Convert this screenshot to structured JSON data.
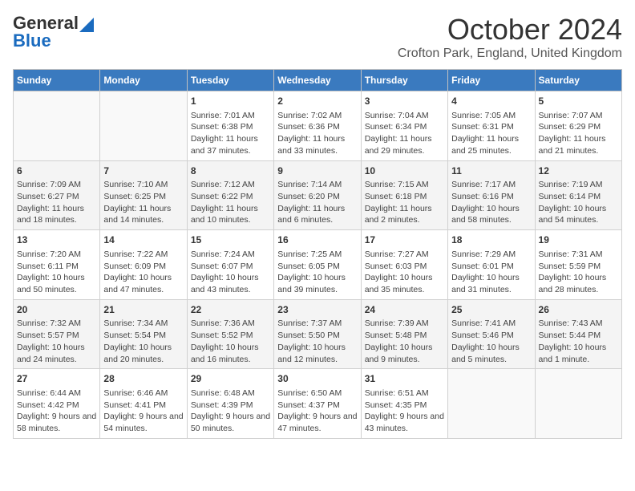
{
  "header": {
    "logo_line1": "General",
    "logo_line2": "Blue",
    "month_title": "October 2024",
    "location": "Crofton Park, England, United Kingdom"
  },
  "weekdays": [
    "Sunday",
    "Monday",
    "Tuesday",
    "Wednesday",
    "Thursday",
    "Friday",
    "Saturday"
  ],
  "weeks": [
    [
      {
        "day": "",
        "info": ""
      },
      {
        "day": "",
        "info": ""
      },
      {
        "day": "1",
        "info": "Sunrise: 7:01 AM\nSunset: 6:38 PM\nDaylight: 11 hours and 37 minutes."
      },
      {
        "day": "2",
        "info": "Sunrise: 7:02 AM\nSunset: 6:36 PM\nDaylight: 11 hours and 33 minutes."
      },
      {
        "day": "3",
        "info": "Sunrise: 7:04 AM\nSunset: 6:34 PM\nDaylight: 11 hours and 29 minutes."
      },
      {
        "day": "4",
        "info": "Sunrise: 7:05 AM\nSunset: 6:31 PM\nDaylight: 11 hours and 25 minutes."
      },
      {
        "day": "5",
        "info": "Sunrise: 7:07 AM\nSunset: 6:29 PM\nDaylight: 11 hours and 21 minutes."
      }
    ],
    [
      {
        "day": "6",
        "info": "Sunrise: 7:09 AM\nSunset: 6:27 PM\nDaylight: 11 hours and 18 minutes."
      },
      {
        "day": "7",
        "info": "Sunrise: 7:10 AM\nSunset: 6:25 PM\nDaylight: 11 hours and 14 minutes."
      },
      {
        "day": "8",
        "info": "Sunrise: 7:12 AM\nSunset: 6:22 PM\nDaylight: 11 hours and 10 minutes."
      },
      {
        "day": "9",
        "info": "Sunrise: 7:14 AM\nSunset: 6:20 PM\nDaylight: 11 hours and 6 minutes."
      },
      {
        "day": "10",
        "info": "Sunrise: 7:15 AM\nSunset: 6:18 PM\nDaylight: 11 hours and 2 minutes."
      },
      {
        "day": "11",
        "info": "Sunrise: 7:17 AM\nSunset: 6:16 PM\nDaylight: 10 hours and 58 minutes."
      },
      {
        "day": "12",
        "info": "Sunrise: 7:19 AM\nSunset: 6:14 PM\nDaylight: 10 hours and 54 minutes."
      }
    ],
    [
      {
        "day": "13",
        "info": "Sunrise: 7:20 AM\nSunset: 6:11 PM\nDaylight: 10 hours and 50 minutes."
      },
      {
        "day": "14",
        "info": "Sunrise: 7:22 AM\nSunset: 6:09 PM\nDaylight: 10 hours and 47 minutes."
      },
      {
        "day": "15",
        "info": "Sunrise: 7:24 AM\nSunset: 6:07 PM\nDaylight: 10 hours and 43 minutes."
      },
      {
        "day": "16",
        "info": "Sunrise: 7:25 AM\nSunset: 6:05 PM\nDaylight: 10 hours and 39 minutes."
      },
      {
        "day": "17",
        "info": "Sunrise: 7:27 AM\nSunset: 6:03 PM\nDaylight: 10 hours and 35 minutes."
      },
      {
        "day": "18",
        "info": "Sunrise: 7:29 AM\nSunset: 6:01 PM\nDaylight: 10 hours and 31 minutes."
      },
      {
        "day": "19",
        "info": "Sunrise: 7:31 AM\nSunset: 5:59 PM\nDaylight: 10 hours and 28 minutes."
      }
    ],
    [
      {
        "day": "20",
        "info": "Sunrise: 7:32 AM\nSunset: 5:57 PM\nDaylight: 10 hours and 24 minutes."
      },
      {
        "day": "21",
        "info": "Sunrise: 7:34 AM\nSunset: 5:54 PM\nDaylight: 10 hours and 20 minutes."
      },
      {
        "day": "22",
        "info": "Sunrise: 7:36 AM\nSunset: 5:52 PM\nDaylight: 10 hours and 16 minutes."
      },
      {
        "day": "23",
        "info": "Sunrise: 7:37 AM\nSunset: 5:50 PM\nDaylight: 10 hours and 12 minutes."
      },
      {
        "day": "24",
        "info": "Sunrise: 7:39 AM\nSunset: 5:48 PM\nDaylight: 10 hours and 9 minutes."
      },
      {
        "day": "25",
        "info": "Sunrise: 7:41 AM\nSunset: 5:46 PM\nDaylight: 10 hours and 5 minutes."
      },
      {
        "day": "26",
        "info": "Sunrise: 7:43 AM\nSunset: 5:44 PM\nDaylight: 10 hours and 1 minute."
      }
    ],
    [
      {
        "day": "27",
        "info": "Sunrise: 6:44 AM\nSunset: 4:42 PM\nDaylight: 9 hours and 58 minutes."
      },
      {
        "day": "28",
        "info": "Sunrise: 6:46 AM\nSunset: 4:41 PM\nDaylight: 9 hours and 54 minutes."
      },
      {
        "day": "29",
        "info": "Sunrise: 6:48 AM\nSunset: 4:39 PM\nDaylight: 9 hours and 50 minutes."
      },
      {
        "day": "30",
        "info": "Sunrise: 6:50 AM\nSunset: 4:37 PM\nDaylight: 9 hours and 47 minutes."
      },
      {
        "day": "31",
        "info": "Sunrise: 6:51 AM\nSunset: 4:35 PM\nDaylight: 9 hours and 43 minutes."
      },
      {
        "day": "",
        "info": ""
      },
      {
        "day": "",
        "info": ""
      }
    ]
  ]
}
